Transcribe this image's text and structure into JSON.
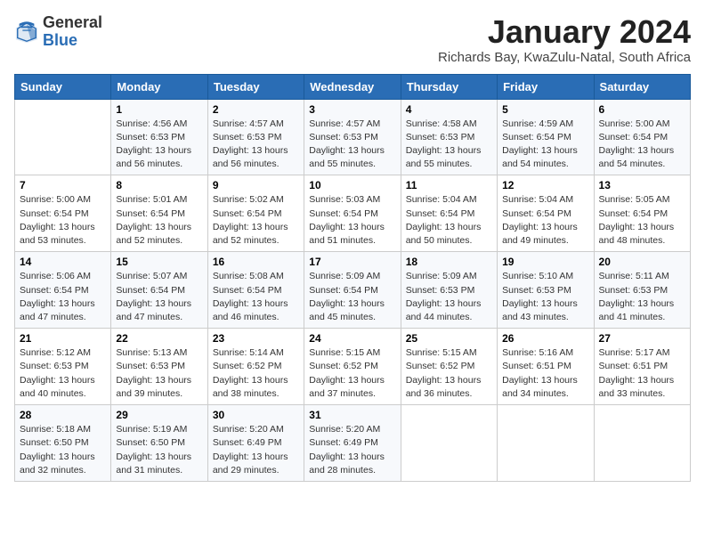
{
  "header": {
    "logo_general": "General",
    "logo_blue": "Blue",
    "month_year": "January 2024",
    "location": "Richards Bay, KwaZulu-Natal, South Africa"
  },
  "weekdays": [
    "Sunday",
    "Monday",
    "Tuesday",
    "Wednesday",
    "Thursday",
    "Friday",
    "Saturday"
  ],
  "weeks": [
    [
      {
        "num": "",
        "sunrise": "",
        "sunset": "",
        "daylight": ""
      },
      {
        "num": "1",
        "sunrise": "Sunrise: 4:56 AM",
        "sunset": "Sunset: 6:53 PM",
        "daylight": "Daylight: 13 hours and 56 minutes."
      },
      {
        "num": "2",
        "sunrise": "Sunrise: 4:57 AM",
        "sunset": "Sunset: 6:53 PM",
        "daylight": "Daylight: 13 hours and 56 minutes."
      },
      {
        "num": "3",
        "sunrise": "Sunrise: 4:57 AM",
        "sunset": "Sunset: 6:53 PM",
        "daylight": "Daylight: 13 hours and 55 minutes."
      },
      {
        "num": "4",
        "sunrise": "Sunrise: 4:58 AM",
        "sunset": "Sunset: 6:53 PM",
        "daylight": "Daylight: 13 hours and 55 minutes."
      },
      {
        "num": "5",
        "sunrise": "Sunrise: 4:59 AM",
        "sunset": "Sunset: 6:54 PM",
        "daylight": "Daylight: 13 hours and 54 minutes."
      },
      {
        "num": "6",
        "sunrise": "Sunrise: 5:00 AM",
        "sunset": "Sunset: 6:54 PM",
        "daylight": "Daylight: 13 hours and 54 minutes."
      }
    ],
    [
      {
        "num": "7",
        "sunrise": "Sunrise: 5:00 AM",
        "sunset": "Sunset: 6:54 PM",
        "daylight": "Daylight: 13 hours and 53 minutes."
      },
      {
        "num": "8",
        "sunrise": "Sunrise: 5:01 AM",
        "sunset": "Sunset: 6:54 PM",
        "daylight": "Daylight: 13 hours and 52 minutes."
      },
      {
        "num": "9",
        "sunrise": "Sunrise: 5:02 AM",
        "sunset": "Sunset: 6:54 PM",
        "daylight": "Daylight: 13 hours and 52 minutes."
      },
      {
        "num": "10",
        "sunrise": "Sunrise: 5:03 AM",
        "sunset": "Sunset: 6:54 PM",
        "daylight": "Daylight: 13 hours and 51 minutes."
      },
      {
        "num": "11",
        "sunrise": "Sunrise: 5:04 AM",
        "sunset": "Sunset: 6:54 PM",
        "daylight": "Daylight: 13 hours and 50 minutes."
      },
      {
        "num": "12",
        "sunrise": "Sunrise: 5:04 AM",
        "sunset": "Sunset: 6:54 PM",
        "daylight": "Daylight: 13 hours and 49 minutes."
      },
      {
        "num": "13",
        "sunrise": "Sunrise: 5:05 AM",
        "sunset": "Sunset: 6:54 PM",
        "daylight": "Daylight: 13 hours and 48 minutes."
      }
    ],
    [
      {
        "num": "14",
        "sunrise": "Sunrise: 5:06 AM",
        "sunset": "Sunset: 6:54 PM",
        "daylight": "Daylight: 13 hours and 47 minutes."
      },
      {
        "num": "15",
        "sunrise": "Sunrise: 5:07 AM",
        "sunset": "Sunset: 6:54 PM",
        "daylight": "Daylight: 13 hours and 47 minutes."
      },
      {
        "num": "16",
        "sunrise": "Sunrise: 5:08 AM",
        "sunset": "Sunset: 6:54 PM",
        "daylight": "Daylight: 13 hours and 46 minutes."
      },
      {
        "num": "17",
        "sunrise": "Sunrise: 5:09 AM",
        "sunset": "Sunset: 6:54 PM",
        "daylight": "Daylight: 13 hours and 45 minutes."
      },
      {
        "num": "18",
        "sunrise": "Sunrise: 5:09 AM",
        "sunset": "Sunset: 6:53 PM",
        "daylight": "Daylight: 13 hours and 44 minutes."
      },
      {
        "num": "19",
        "sunrise": "Sunrise: 5:10 AM",
        "sunset": "Sunset: 6:53 PM",
        "daylight": "Daylight: 13 hours and 43 minutes."
      },
      {
        "num": "20",
        "sunrise": "Sunrise: 5:11 AM",
        "sunset": "Sunset: 6:53 PM",
        "daylight": "Daylight: 13 hours and 41 minutes."
      }
    ],
    [
      {
        "num": "21",
        "sunrise": "Sunrise: 5:12 AM",
        "sunset": "Sunset: 6:53 PM",
        "daylight": "Daylight: 13 hours and 40 minutes."
      },
      {
        "num": "22",
        "sunrise": "Sunrise: 5:13 AM",
        "sunset": "Sunset: 6:53 PM",
        "daylight": "Daylight: 13 hours and 39 minutes."
      },
      {
        "num": "23",
        "sunrise": "Sunrise: 5:14 AM",
        "sunset": "Sunset: 6:52 PM",
        "daylight": "Daylight: 13 hours and 38 minutes."
      },
      {
        "num": "24",
        "sunrise": "Sunrise: 5:15 AM",
        "sunset": "Sunset: 6:52 PM",
        "daylight": "Daylight: 13 hours and 37 minutes."
      },
      {
        "num": "25",
        "sunrise": "Sunrise: 5:15 AM",
        "sunset": "Sunset: 6:52 PM",
        "daylight": "Daylight: 13 hours and 36 minutes."
      },
      {
        "num": "26",
        "sunrise": "Sunrise: 5:16 AM",
        "sunset": "Sunset: 6:51 PM",
        "daylight": "Daylight: 13 hours and 34 minutes."
      },
      {
        "num": "27",
        "sunrise": "Sunrise: 5:17 AM",
        "sunset": "Sunset: 6:51 PM",
        "daylight": "Daylight: 13 hours and 33 minutes."
      }
    ],
    [
      {
        "num": "28",
        "sunrise": "Sunrise: 5:18 AM",
        "sunset": "Sunset: 6:50 PM",
        "daylight": "Daylight: 13 hours and 32 minutes."
      },
      {
        "num": "29",
        "sunrise": "Sunrise: 5:19 AM",
        "sunset": "Sunset: 6:50 PM",
        "daylight": "Daylight: 13 hours and 31 minutes."
      },
      {
        "num": "30",
        "sunrise": "Sunrise: 5:20 AM",
        "sunset": "Sunset: 6:49 PM",
        "daylight": "Daylight: 13 hours and 29 minutes."
      },
      {
        "num": "31",
        "sunrise": "Sunrise: 5:20 AM",
        "sunset": "Sunset: 6:49 PM",
        "daylight": "Daylight: 13 hours and 28 minutes."
      },
      {
        "num": "",
        "sunrise": "",
        "sunset": "",
        "daylight": ""
      },
      {
        "num": "",
        "sunrise": "",
        "sunset": "",
        "daylight": ""
      },
      {
        "num": "",
        "sunrise": "",
        "sunset": "",
        "daylight": ""
      }
    ]
  ]
}
